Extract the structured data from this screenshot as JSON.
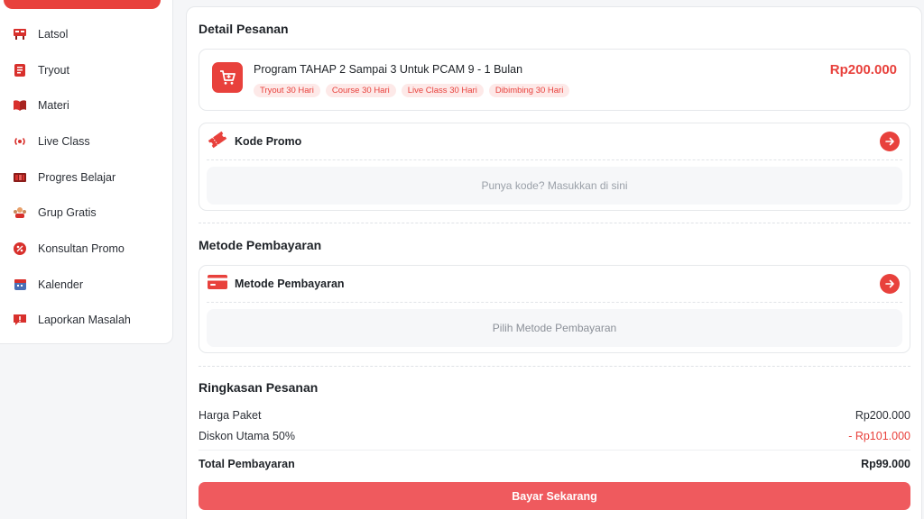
{
  "sidebar": {
    "items": [
      {
        "label": "Latsol",
        "icon": "board-icon"
      },
      {
        "label": "Tryout",
        "icon": "exam-icon"
      },
      {
        "label": "Materi",
        "icon": "book-icon"
      },
      {
        "label": "Live Class",
        "icon": "broadcast-icon"
      },
      {
        "label": "Progres Belajar",
        "icon": "progress-icon"
      },
      {
        "label": "Grup Gratis",
        "icon": "group-icon"
      },
      {
        "label": "Konsultan Promo",
        "icon": "promo-icon"
      },
      {
        "label": "Kalender",
        "icon": "calendar-icon"
      },
      {
        "label": "Laporkan Masalah",
        "icon": "report-icon"
      }
    ]
  },
  "order": {
    "title": "Detail Pesanan",
    "product_name": "Program TAHAP 2 Sampai 3 Untuk PCAM 9 - 1 Bulan",
    "price": "Rp200.000",
    "tags": [
      "Tryout 30 Hari",
      "Course 30 Hari",
      "Live Class 30 Hari",
      "Dibimbing 30 Hari"
    ]
  },
  "promo": {
    "label": "Kode Promo",
    "placeholder": "Punya kode? Masukkan di sini"
  },
  "payment": {
    "title": "Metode Pembayaran",
    "label": "Metode Pembayaran",
    "placeholder": "Pilih Metode Pembayaran"
  },
  "summary": {
    "title": "Ringkasan Pesanan",
    "package_label": "Harga Paket",
    "package_value": "Rp200.000",
    "discount_label": "Diskon Utama 50%",
    "discount_value": "- Rp101.000",
    "total_label": "Total Pembayaran",
    "total_value": "Rp99.000"
  },
  "cta": {
    "label": "Bayar Sekarang"
  },
  "colors": {
    "accent": "#e8413c",
    "button": "#ef5a5e"
  }
}
